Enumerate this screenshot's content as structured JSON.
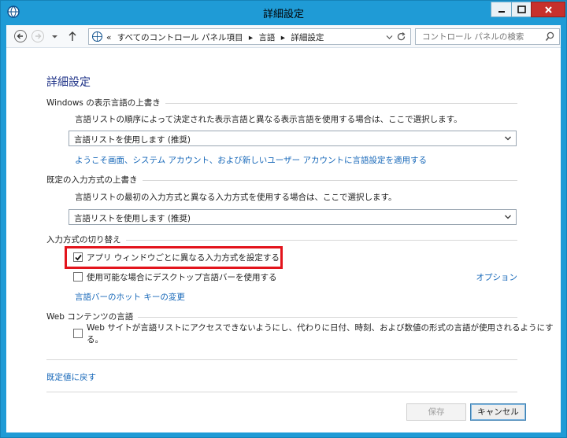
{
  "window": {
    "title": "詳細設定",
    "app_icon": "language-globe-icon",
    "controls": [
      "minimize-icon",
      "maximize-icon",
      "close-icon"
    ]
  },
  "nav": {
    "breadcrumb_prefix": "«",
    "breadcrumbs": [
      "すべてのコントロール パネル項目",
      "言語",
      "詳細設定"
    ],
    "search_placeholder": "コントロール パネルの検索"
  },
  "page": {
    "title": "詳細設定",
    "display_override": {
      "heading": "Windows の表示言語の上書き",
      "description": "言語リストの順序によって決定された表示言語と異なる表示言語を使用する場合は、ここで選択します。",
      "select_value": "言語リストを使用します (推奨)",
      "link": "ようこそ画面、システム アカウント、および新しいユーザー アカウントに言語設定を適用する"
    },
    "input_override": {
      "heading": "既定の入力方式の上書き",
      "description": "言語リストの最初の入力方式と異なる入力方式を使用する場合は、ここで選択します。",
      "select_value": "言語リストを使用します (推奨)"
    },
    "switching": {
      "heading": "入力方式の切り替え",
      "per_app_label": "アプリ ウィンドウごとに異なる入力方式を設定する",
      "per_app_checked": true,
      "desktop_bar_label": "使用可能な場合にデスクトップ言語バーを使用する",
      "desktop_bar_checked": false,
      "options_link": "オプション",
      "hotkey_link": "言語バーのホット キーの変更"
    },
    "web": {
      "heading": "Web コンテンツの言語",
      "label": "Web サイトが言語リストにアクセスできないようにし、代わりに日付、時刻、および数値の形式の言語が使用されるようにする。",
      "checked": false
    },
    "restore_link": "既定値に戻す",
    "save_label": "保存",
    "cancel_label": "キャンセル"
  },
  "colors": {
    "frame": "#1f9bd6",
    "link": "#1466b8",
    "highlight": "#e3141c",
    "title": "#1e3287"
  }
}
